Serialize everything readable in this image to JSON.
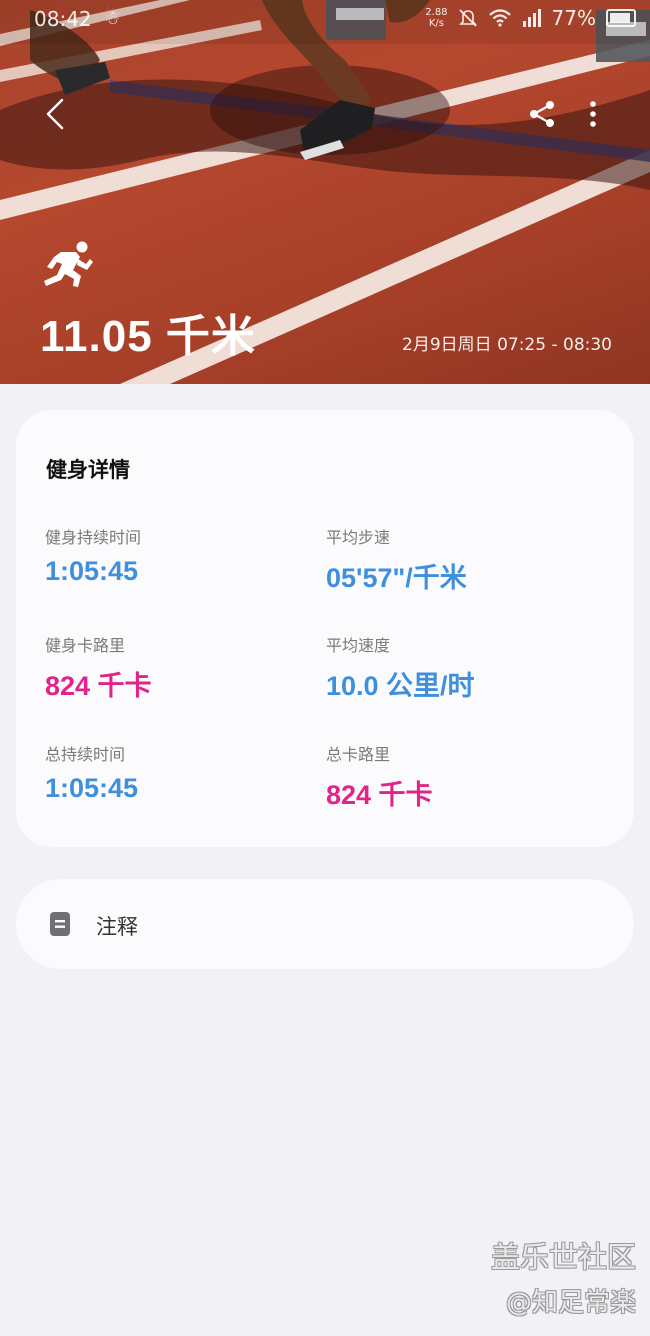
{
  "status_bar": {
    "time": "08:42",
    "network_speed": "2.88",
    "network_unit": "K/s",
    "battery": "77%"
  },
  "workout": {
    "distance": "11.05 千米",
    "date_range": "2月9日周日 07:25 - 08:30"
  },
  "details": {
    "title": "健身详情",
    "metrics": [
      {
        "label": "健身持续时间",
        "value": "1:05:45",
        "color": "#3f8fdc"
      },
      {
        "label": "平均步速",
        "value": "05'57\"/千米",
        "color": "#3f8fdc"
      },
      {
        "label": "健身卡路里",
        "value": "824 千卡",
        "color": "#e2248a"
      },
      {
        "label": "平均速度",
        "value": "10.0 公里/时",
        "color": "#3f8fdc"
      },
      {
        "label": "总持续时间",
        "value": "1:05:45",
        "color": "#3f8fdc"
      },
      {
        "label": "总卡路里",
        "value": "824 千卡",
        "color": "#e2248a"
      }
    ]
  },
  "note": {
    "label": "注释"
  },
  "watermark": {
    "line1": "盖乐世社区",
    "line2": "@知足常楽"
  },
  "icons": {
    "back": "chevron-left-icon",
    "share": "share-icon",
    "more": "more-vertical-icon",
    "activity": "running-icon",
    "note": "note-icon"
  }
}
